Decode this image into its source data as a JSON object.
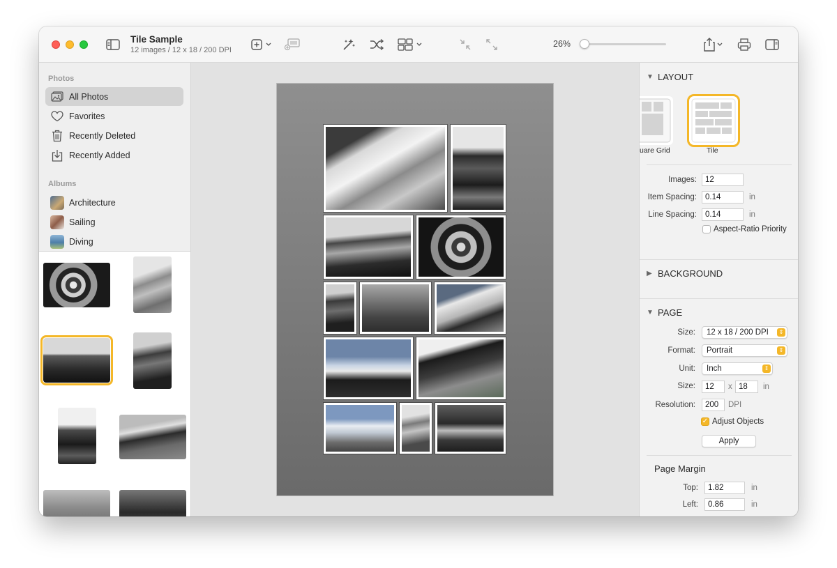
{
  "window": {
    "title": "Tile Sample",
    "subtitle": "12 images / 12 x 18 / 200 DPI"
  },
  "toolbar": {
    "icons": [
      "sidebar-toggle-icon",
      "add-icon",
      "add-media-icon",
      "magic-wand-icon",
      "shuffle-icon",
      "layout-options-icon",
      "collapse-icon",
      "expand-icon",
      "share-icon",
      "print-icon",
      "inspector-toggle-icon"
    ],
    "zoom_label": "26%",
    "zoom_value": 0.02
  },
  "sidebar": {
    "photos_header": "Photos",
    "photos": [
      {
        "label": "All Photos",
        "icon": "photos-icon",
        "selected": true
      },
      {
        "label": "Favorites",
        "icon": "heart-icon"
      },
      {
        "label": "Recently Deleted",
        "icon": "trash-icon"
      },
      {
        "label": "Recently Added",
        "icon": "import-icon"
      }
    ],
    "albums_header": "Albums",
    "albums": [
      {
        "label": "Architecture",
        "color": "#6a7f9a"
      },
      {
        "label": "Sailing",
        "color": "#b98a74"
      },
      {
        "label": "Diving",
        "color": "#6f8fa8"
      }
    ]
  },
  "inspector": {
    "layout": {
      "header": "LAYOUT",
      "options": [
        {
          "label": "uare Grid"
        },
        {
          "label": "Tile",
          "selected": true
        }
      ],
      "images_label": "Images:",
      "images_value": "12",
      "item_spacing_label": "Item Spacing:",
      "item_spacing_value": "0.14",
      "item_spacing_unit": "in",
      "line_spacing_label": "Line Spacing:",
      "line_spacing_value": "0.14",
      "line_spacing_unit": "in",
      "aspect_label": "Aspect-Ratio Priority",
      "aspect_checked": false
    },
    "background": {
      "header": "BACKGROUND"
    },
    "page": {
      "header": "PAGE",
      "size_label": "Size:",
      "size_value": "12 x 18 / 200 DPI",
      "format_label": "Format:",
      "format_value": "Portrait",
      "unit_label": "Unit:",
      "unit_value": "Inch",
      "dim_label": "Size:",
      "width": "12",
      "times": "x",
      "height": "18",
      "dim_unit": "in",
      "resolution_label": "Resolution:",
      "resolution_value": "200",
      "resolution_unit": "DPI",
      "adjust_label": "Adjust Objects",
      "adjust_checked": true,
      "apply_label": "Apply"
    },
    "margin": {
      "header": "Page Margin",
      "top_label": "Top:",
      "top_value": "1.82",
      "top_unit": "in",
      "left_label": "Left:",
      "left_value": "0.86",
      "left_unit": "in"
    }
  },
  "colors": {
    "accent": "#f4b728",
    "selection": "#d3d3d3"
  }
}
